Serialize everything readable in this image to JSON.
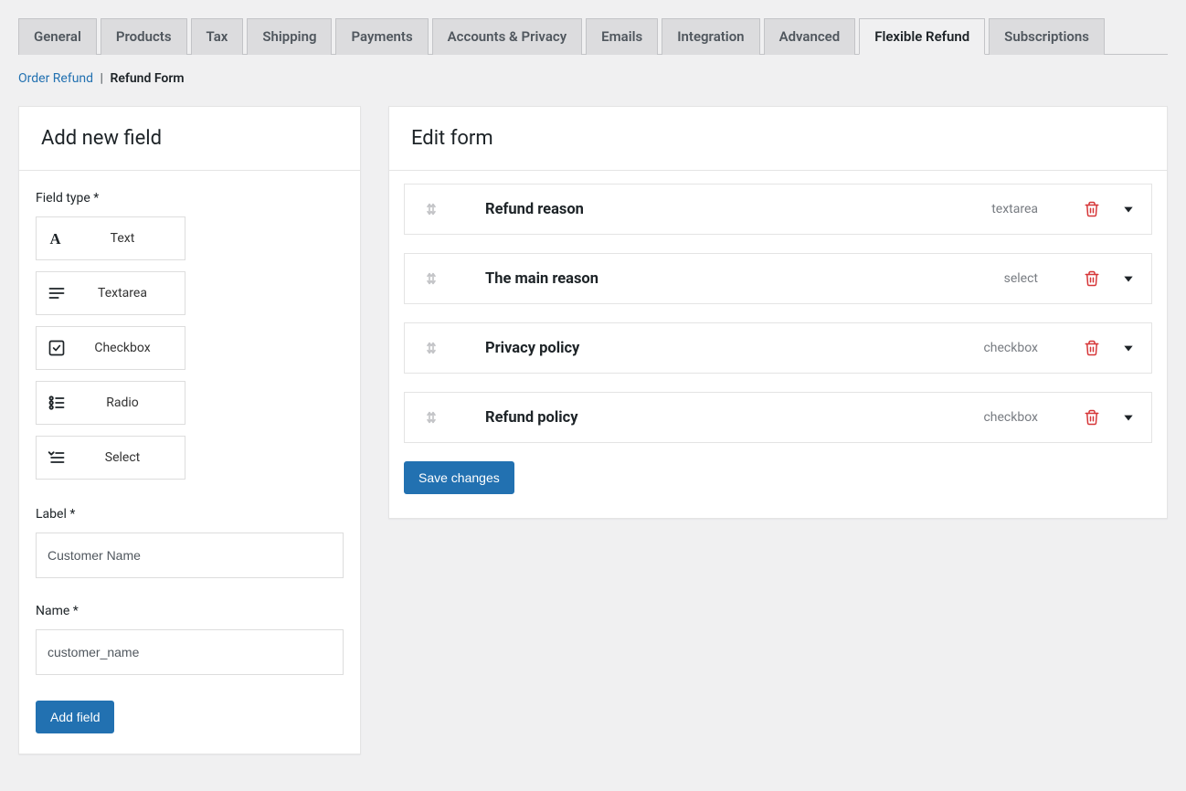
{
  "tabs": [
    {
      "label": "General"
    },
    {
      "label": "Products"
    },
    {
      "label": "Tax"
    },
    {
      "label": "Shipping"
    },
    {
      "label": "Payments"
    },
    {
      "label": "Accounts & Privacy"
    },
    {
      "label": "Emails"
    },
    {
      "label": "Integration"
    },
    {
      "label": "Advanced"
    },
    {
      "label": "Flexible Refund",
      "active": true
    },
    {
      "label": "Subscriptions"
    }
  ],
  "subnav": {
    "link": "Order Refund",
    "current": "Refund Form"
  },
  "sidebar": {
    "title": "Add new field",
    "field_type_label": "Field type *",
    "types": {
      "text": "Text",
      "textarea": "Textarea",
      "checkbox": "Checkbox",
      "radio": "Radio",
      "select": "Select"
    },
    "label_label": "Label *",
    "label_value": "Customer Name",
    "name_label": "Name *",
    "name_value": "customer_name",
    "add_button": "Add field"
  },
  "main": {
    "title": "Edit form",
    "rows": [
      {
        "title": "Refund reason",
        "type": "textarea"
      },
      {
        "title": "The main reason",
        "type": "select"
      },
      {
        "title": "Privacy policy",
        "type": "checkbox"
      },
      {
        "title": "Refund policy",
        "type": "checkbox"
      }
    ],
    "save_button": "Save changes"
  }
}
